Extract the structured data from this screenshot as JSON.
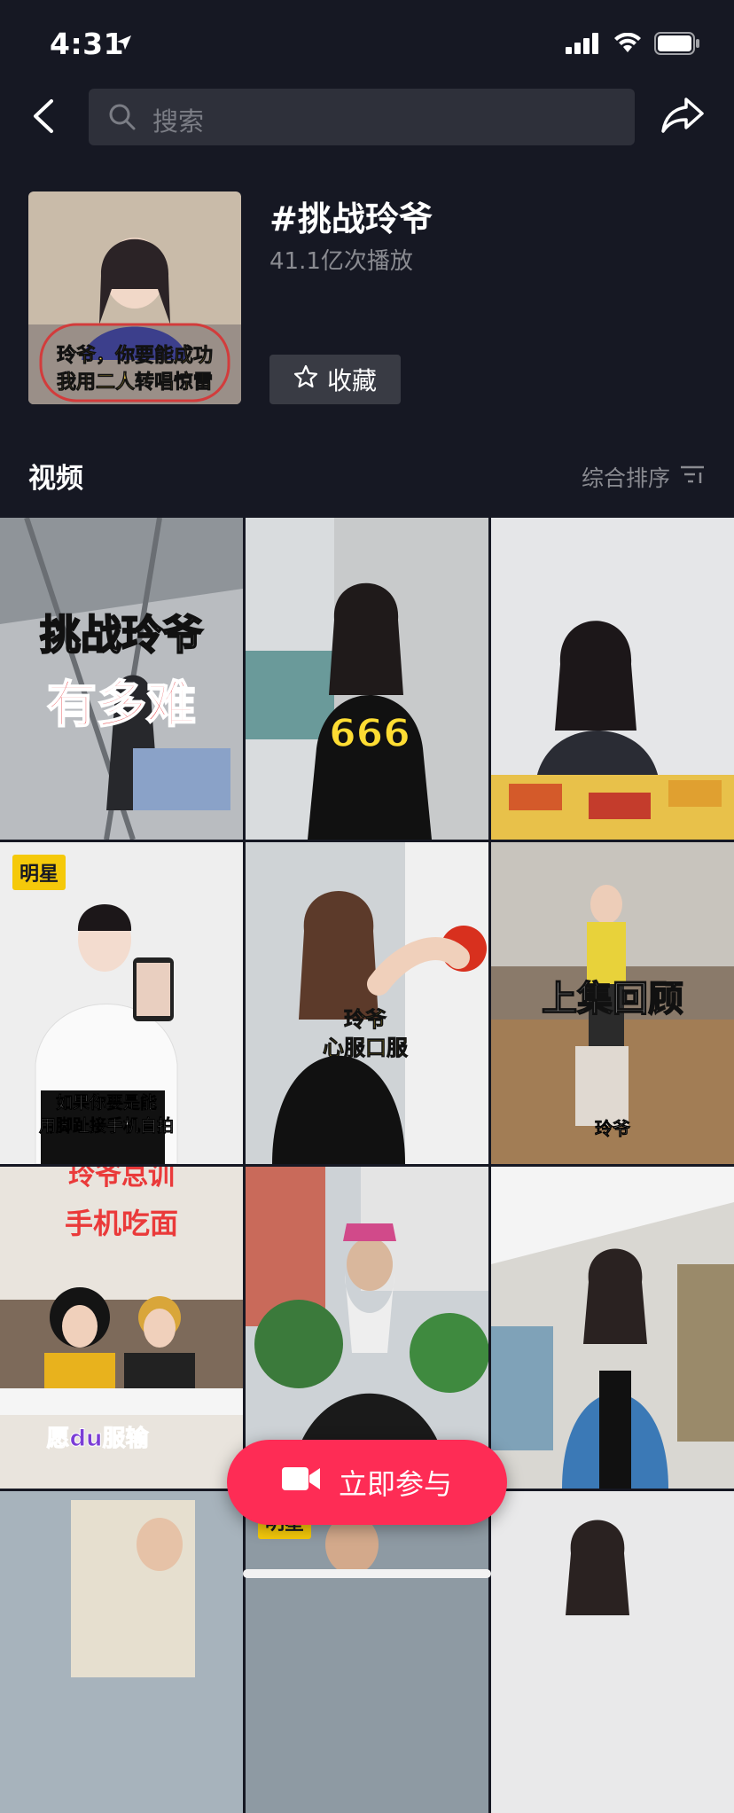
{
  "status": {
    "time": "4:31"
  },
  "search": {
    "placeholder": "搜索"
  },
  "challenge": {
    "title": "#挑战玲爷",
    "plays": "41.1亿次播放",
    "favorite_label": "收藏",
    "cover_caption_1": "玲爷，你要能成功",
    "cover_caption_2": "我用二人转唱惊雷"
  },
  "section": {
    "title": "视频",
    "sort_label": "综合排序"
  },
  "videos": [
    {
      "caption": "挑战玲爷",
      "caption2": "有多难",
      "badge": ""
    },
    {
      "caption": "666",
      "caption2": "",
      "badge": ""
    },
    {
      "caption": "",
      "caption2": "",
      "badge": ""
    },
    {
      "caption": "如果你要是能",
      "caption2": "用脚趾接手机自拍",
      "badge": "明星"
    },
    {
      "caption": "玲爷",
      "caption2": "心服口服",
      "badge": ""
    },
    {
      "caption": "上集回顾",
      "caption2": "玲爷",
      "badge": ""
    },
    {
      "caption": "玲爷总训",
      "caption2": "手机吃面",
      "caption3": "愿du服输",
      "badge": ""
    },
    {
      "caption": "",
      "caption2": "",
      "badge": ""
    },
    {
      "caption": "",
      "caption2": "",
      "badge": ""
    },
    {
      "caption": "",
      "caption2": "",
      "badge": ""
    },
    {
      "caption": "",
      "caption2": "",
      "badge": "明星"
    },
    {
      "caption": "",
      "caption2": "",
      "badge": ""
    }
  ],
  "join_button": {
    "label": "立即参与"
  },
  "colors": {
    "background": "#161823",
    "accent": "#fe2c55",
    "badge": "#f5c90a"
  },
  "icons": [
    "location-arrow-icon",
    "signal-icon",
    "wifi-icon",
    "battery-icon",
    "back-icon",
    "search-icon",
    "share-icon",
    "star-icon",
    "sort-icon",
    "camera-icon"
  ]
}
